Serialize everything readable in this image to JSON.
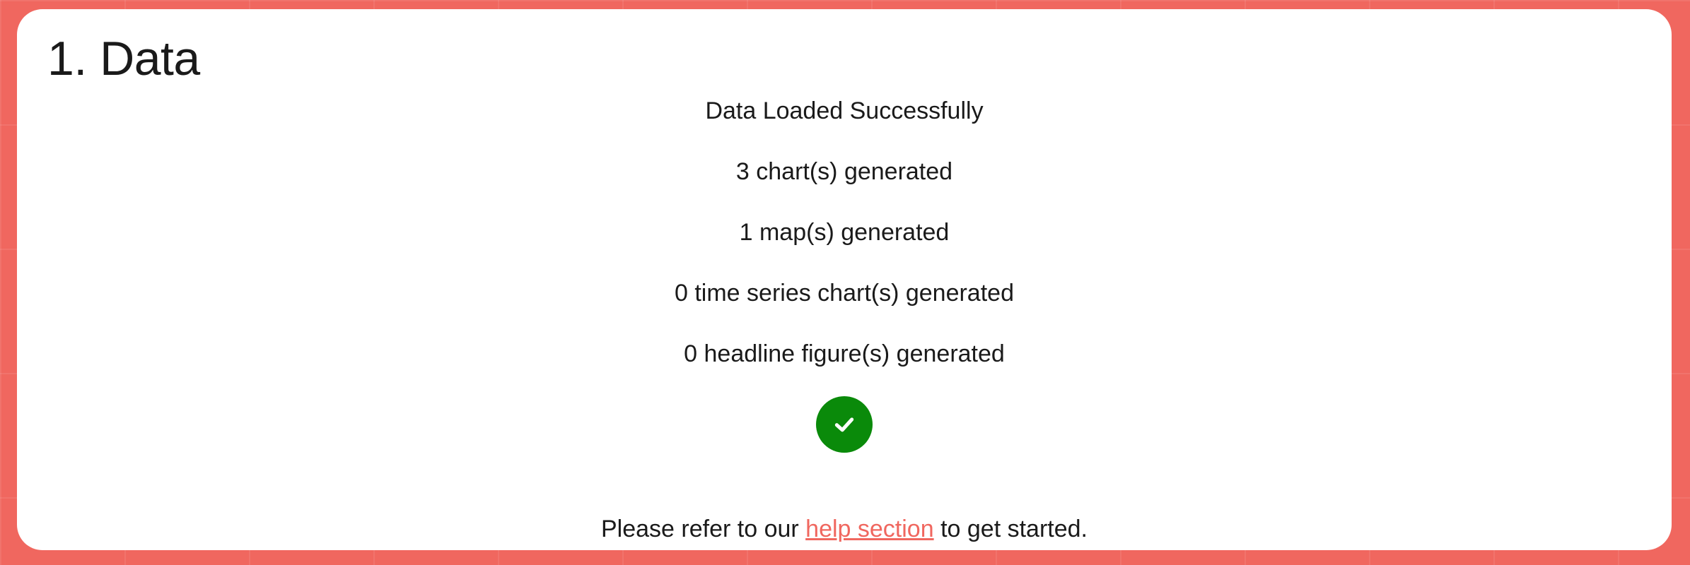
{
  "section": {
    "title": "1. Data"
  },
  "status": {
    "message": "Data Loaded Successfully",
    "charts": "3 chart(s) generated",
    "maps": "1 map(s) generated",
    "time_series": "0 time series chart(s) generated",
    "headlines": "0 headline figure(s) generated",
    "success_icon": "check-circle-icon",
    "success_color": "#0a8a0a"
  },
  "help": {
    "prefix": "Please refer to our ",
    "link_text": "help section",
    "suffix": " to get started."
  },
  "colors": {
    "background": "#f0675f",
    "link": "#f0675f",
    "card": "#ffffff"
  }
}
